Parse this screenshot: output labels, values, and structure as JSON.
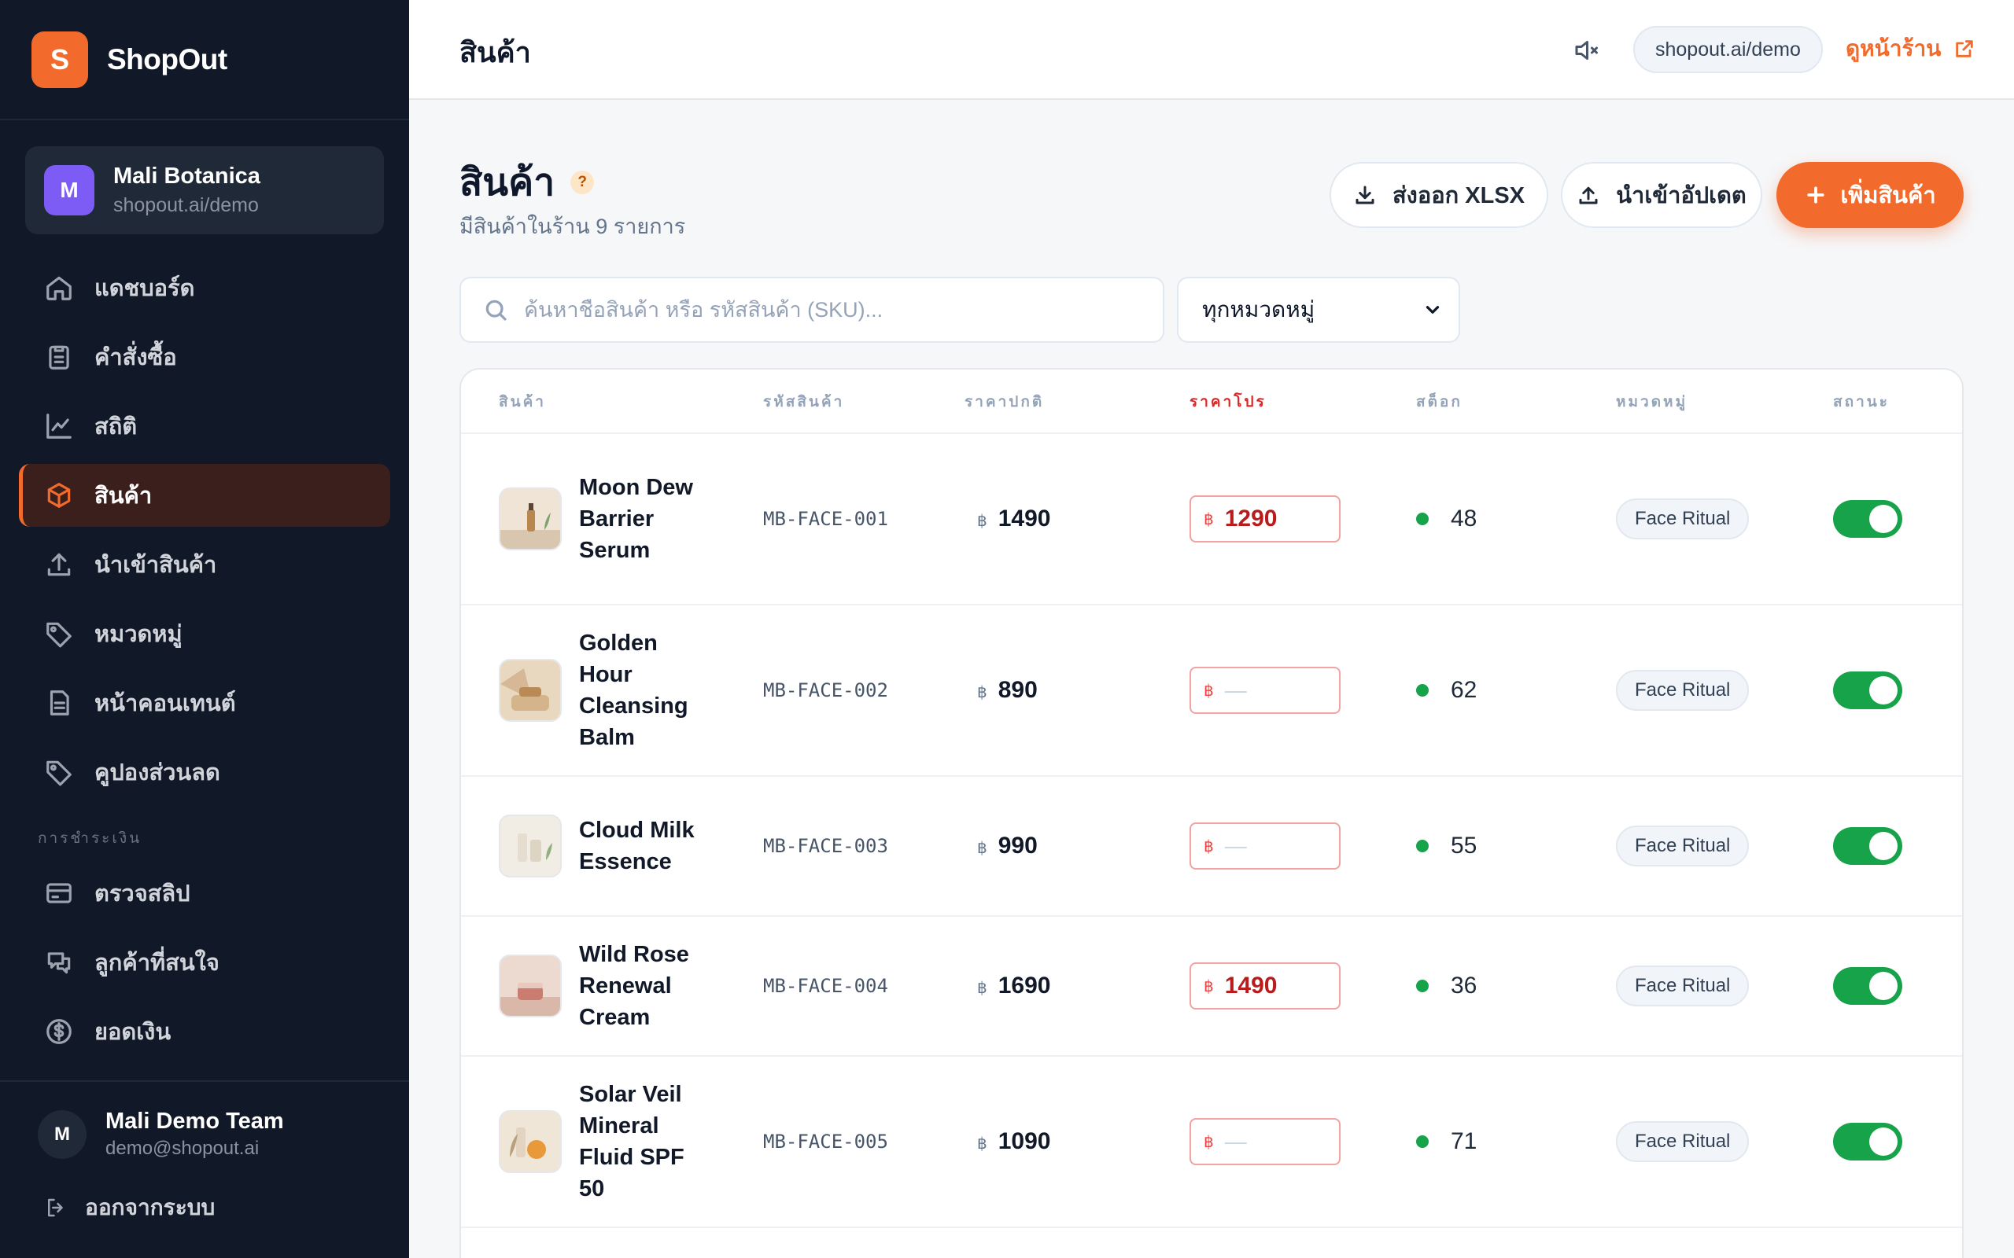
{
  "brand": {
    "logo_letter": "S",
    "name": "ShopOut",
    "accent": "#f26b2c"
  },
  "store": {
    "avatar_letter": "M",
    "name": "Mali Botanica",
    "url": "shopout.ai/demo"
  },
  "nav": {
    "items": [
      {
        "label": "แดชบอร์ด",
        "icon": "home-icon"
      },
      {
        "label": "คำสั่งซื้อ",
        "icon": "clipboard-icon"
      },
      {
        "label": "สถิติ",
        "icon": "chart-line-icon"
      },
      {
        "label": "สินค้า",
        "icon": "box-icon",
        "active": true
      },
      {
        "label": "นำเข้าสินค้า",
        "icon": "upload-icon"
      },
      {
        "label": "หมวดหมู่",
        "icon": "tag-icon"
      },
      {
        "label": "หน้าคอนเทนต์",
        "icon": "document-icon"
      },
      {
        "label": "คูปองส่วนลด",
        "icon": "coupon-tag-icon"
      }
    ],
    "section_label": "การชำระเงิน",
    "payment_items": [
      {
        "label": "ตรวจสลิป",
        "icon": "card-icon"
      },
      {
        "label": "ลูกค้าที่สนใจ",
        "icon": "chat-icon"
      },
      {
        "label": "ยอดเงิน",
        "icon": "dollar-icon"
      }
    ]
  },
  "user": {
    "avatar_letter": "M",
    "name": "Mali Demo Team",
    "email": "demo@shopout.ai",
    "logout_label": "ออกจากระบบ"
  },
  "topbar": {
    "title": "สินค้า",
    "store_url": "shopout.ai/demo",
    "view_store_label": "ดูหน้าร้าน"
  },
  "page": {
    "title": "สินค้า",
    "help": "?",
    "subtitle": "มีสินค้าในร้าน 9 รายการ",
    "export_label": "ส่งออก XLSX",
    "import_label": "นำเข้าอัปเดต",
    "add_label": "เพิ่มสินค้า"
  },
  "search": {
    "placeholder": "ค้นหาชื่อสินค้า หรือ รหัสสินค้า (SKU)...",
    "value": ""
  },
  "category_filter": {
    "selected": "ทุกหมวดหมู่"
  },
  "table": {
    "headers": {
      "product": "สินค้า",
      "sku": "รหัสสินค้า",
      "price": "ราคาปกติ",
      "promo": "ราคาโปร",
      "stock": "สต็อก",
      "category": "หมวดหมู่",
      "status": "สถานะ"
    },
    "currency": "฿",
    "empty_promo": "—",
    "rows": [
      {
        "name": "Moon Dew Barrier Serum",
        "sku": "MB-FACE-001",
        "price": "1490",
        "promo": "1290",
        "stock": "48",
        "category": "Face Ritual",
        "enabled": true
      },
      {
        "name": "Golden Hour Cleansing Balm",
        "sku": "MB-FACE-002",
        "price": "890",
        "promo": "",
        "stock": "62",
        "category": "Face Ritual",
        "enabled": true
      },
      {
        "name": "Cloud Milk Essence",
        "sku": "MB-FACE-003",
        "price": "990",
        "promo": "",
        "stock": "55",
        "category": "Face Ritual",
        "enabled": true
      },
      {
        "name": "Wild Rose Renewal Cream",
        "sku": "MB-FACE-004",
        "price": "1690",
        "promo": "1490",
        "stock": "36",
        "category": "Face Ritual",
        "enabled": true
      },
      {
        "name": "Solar Veil Mineral Fluid SPF 50",
        "sku": "MB-FACE-005",
        "price": "1090",
        "promo": "",
        "stock": "71",
        "category": "Face Ritual",
        "enabled": true
      }
    ]
  }
}
